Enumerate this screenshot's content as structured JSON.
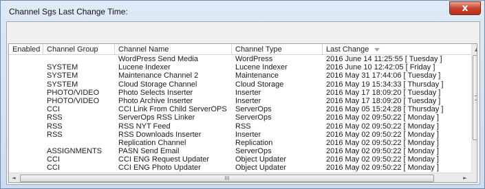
{
  "window": {
    "title": "Channel Sgs Last Change Time:",
    "close_glyph": "x"
  },
  "table": {
    "columns": [
      "Enabled",
      "Channel Group",
      "Channel Name",
      "Channel Type",
      "Last Change"
    ],
    "sorted_column": "Last Change",
    "sort_direction": "descending",
    "status_colors": {
      "green": "#2e8b22",
      "yellow": "#f2d400"
    },
    "rows": [
      {
        "enabled": "green",
        "group": "",
        "name": "WordPress Send Media",
        "type": "WordPress",
        "last_change": "2016 June 14 11:25:55  [ Tuesday ]"
      },
      {
        "enabled": "green",
        "group": "SYSTEM",
        "name": "Lucene Indexer",
        "type": "Lucene Indexer",
        "last_change": "2016 June 10 12:42:05  [ Friday ]"
      },
      {
        "enabled": "green",
        "group": "SYSTEM",
        "name": "Maintenance Channel 2",
        "type": "Maintenance",
        "last_change": "2016 May 31 17:44:06  [ Tuesday ]"
      },
      {
        "enabled": "green",
        "group": "SYSTEM",
        "name": "Cloud Storage Channel",
        "type": "Cloud Storage",
        "last_change": "2016 May 19 15:34:33  [ Thursday ]"
      },
      {
        "enabled": "green",
        "group": "PHOTO/VIDEO",
        "name": "Photo Selects Inserter",
        "type": "Inserter",
        "last_change": "2016 May 17 18:09:20  [ Tuesday ]"
      },
      {
        "enabled": "green",
        "group": "PHOTO/VIDEO",
        "name": "Photo Archive Inserter",
        "type": "Inserter",
        "last_change": "2016 May 17 18:09:20  [ Tuesday ]"
      },
      {
        "enabled": "green",
        "group": "CCI",
        "name": "CCI Link From Child ServerOPS",
        "type": "ServerOps",
        "last_change": "2016 May 05 15:24:28  [ Thursday ]"
      },
      {
        "enabled": "green",
        "group": "RSS",
        "name": "ServerOps RSS Linker",
        "type": "ServerOps",
        "last_change": "2016 May 02 09:50:22  [ Monday ]"
      },
      {
        "enabled": "green",
        "group": "RSS",
        "name": "RSS NYT Feed",
        "type": "RSS",
        "last_change": "2016 May 02 09:50:22  [ Monday ]"
      },
      {
        "enabled": "green",
        "group": "RSS",
        "name": "RSS Downloads Inserter",
        "type": "Inserter",
        "last_change": "2016 May 02 09:50:22  [ Monday ]"
      },
      {
        "enabled": "yellow",
        "group": "",
        "name": "Replication Channel",
        "type": "Replication",
        "last_change": "2016 May 02 09:50:22  [ Monday ]"
      },
      {
        "enabled": "green",
        "group": "ASSIGNMENTS",
        "name": "PASN Send Email",
        "type": "ServerOps",
        "last_change": "2016 May 02 09:50:22  [ Monday ]"
      },
      {
        "enabled": "green",
        "group": "CCI",
        "name": "CCI ENG Request Updater",
        "type": "Object Updater",
        "last_change": "2016 May 02 09:50:22  [ Monday ]"
      },
      {
        "enabled": "green",
        "group": "CCI",
        "name": "CCI ENG Photo Updater",
        "type": "Object Updater",
        "last_change": "2016 May 02 09:50:22  [ Monday ]"
      }
    ]
  },
  "scrollbars": {
    "hthumb_grip": "III",
    "up_glyph": "▲",
    "left_glyph": "◄",
    "right_glyph": "►"
  }
}
